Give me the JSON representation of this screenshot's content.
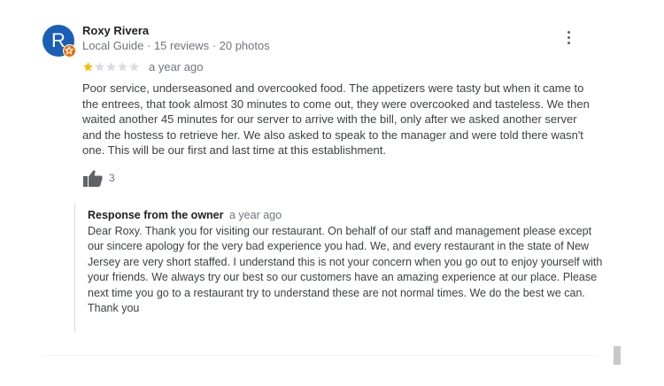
{
  "review": {
    "author_initial": "R",
    "author_name": "Roxy Rivera",
    "author_meta": "Local Guide · 15 reviews · 20 photos",
    "rating": 1,
    "rating_max": 5,
    "date": "a year ago",
    "text": "Poor service, underseasoned and overcooked food. The appetizers were tasty but when it came to the entrees, that took almost 30 minutes to come out, they were overcooked and tasteless. We then waited another 45 minutes for our server to arrive with the bill, only after we asked another server and the hostess to retrieve her. We also asked to speak to the manager and were told there wasn't one. This will be our first and last time at this establishment.",
    "like_count": "3"
  },
  "owner_response": {
    "title": "Response from the owner",
    "date": "a year ago",
    "text": "Dear Roxy. Thank you for visiting our restaurant. On behalf of our staff and management please except our sincere apology for the very bad experience you had. We, and every restaurant in the state of New Jersey are very short staffed. I understand this is not your concern when you go out to enjoy yourself with your friends. We always try our best so our customers have an amazing experience at our place. Please next time you go to a restaurant try to understand these are not normal times. We do the best we can.\nThank you"
  },
  "colors": {
    "avatar": "#1a5eb8",
    "local_guide_badge": "#e8710a",
    "star_filled": "#fbbc04",
    "star_empty": "#dadce0"
  },
  "icons": [
    "more-vert-icon",
    "star-icon",
    "thumbs-up-icon",
    "local-guide-badge-icon"
  ]
}
